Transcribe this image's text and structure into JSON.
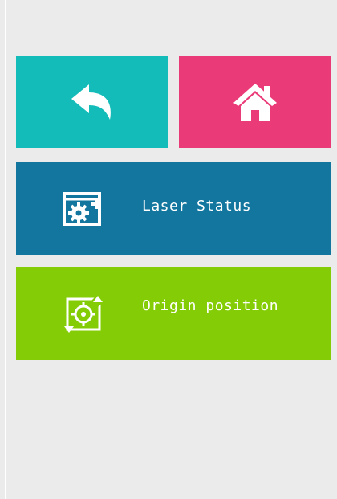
{
  "icons": {
    "back": "undo-arrow-icon",
    "home": "home-icon",
    "laser_status": "settings-panel-icon",
    "origin_position": "crosshair-target-icon"
  },
  "colors": {
    "background": "#ebebeb",
    "back_tile": "#13bcb8",
    "home_tile": "#ea3a78",
    "laser_tile": "#12769e",
    "origin_tile": "#84cc06"
  },
  "menu": {
    "laser_status_label": "Laser Status",
    "origin_position_label": "Origin position"
  }
}
